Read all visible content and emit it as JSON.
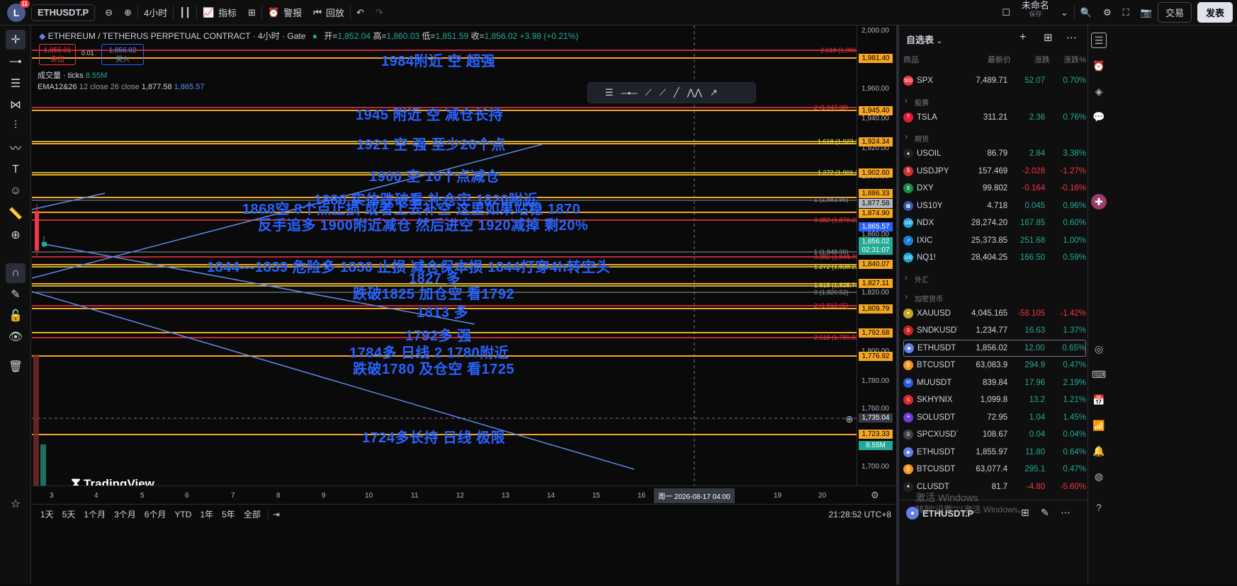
{
  "topbar": {
    "notif": "11",
    "avatar": "L",
    "symbol": "ETHUSDT.P",
    "interval": "4小时",
    "indicators": "指标",
    "alert": "警报",
    "replay": "回放",
    "layout_name": "未命名",
    "layout_sub": "保存",
    "trade": "交易",
    "publish": "发表"
  },
  "legend": {
    "title": "ETHEREUM / TETHERUS PERPETUAL CONTRACT · 4小时 · Gate",
    "o_label": "开=",
    "o": "1,852.04",
    "h_label": "高=",
    "h": "1,860.03",
    "l_label": "低=",
    "l": "1,851.59",
    "c_label": "收=",
    "c": "1,856.02",
    "chg": "+3.98 (+0.21%)",
    "sell_price": "1,856.01",
    "sell_label": "卖出",
    "spread": "0.01",
    "buy_price": "1,856.02",
    "buy_label": "买入",
    "vol_label": "成交量 · ticks",
    "vol_value": "8.55M",
    "ema_label": "EMA12&26",
    "ema_params": "12 close 26 close",
    "ema1": "1,877.58",
    "ema2": "1,865.57"
  },
  "annotations": [
    "1984附近 空 超强",
    "1945 附近 空    减仓长持",
    "1921 空  强 至少20个点",
    "1900 空  10个点减仓",
    "1880  实体跌破看 补仓空  1820附近",
    "1868空  8个点止损  或者上去补空  这里如果站稳 1870",
    "反手追多  1900附近减仓 然后进空 1920减掉 剩20%",
    "1844---1839  危险多 1830 止损  减仓保本损  1844打穿4h转空头",
    "1827 多",
    "跌破1825 加仓空 看1792",
    "1813 多",
    "1792多  强",
    "1784多 日线 2 1780附近",
    "跌破1780 及仓空 看1725",
    "1724多长持  日线 极限"
  ],
  "fib_labels": [
    "2.618 (1,986.58)",
    "2 (1,947.38)",
    "1.618 (1,923.15)",
    "1.272 (1,901.20)",
    "1 (1,883.95)",
    "0.382 (1,870.22)",
    "1 (1,848.00)",
    "0.382 (1,844.75)",
    "1.272 (1,838.22)",
    "1.618 (1,825.78)",
    "0 (1,820.52)",
    "2 (1,812.05)",
    "2.618 (1,789.83)"
  ],
  "price_ticks": [
    "2,000.00",
    "1,960.00",
    "1,940.00",
    "1,920.00",
    "1,900.00",
    "1,860.00",
    "1,820.00",
    "1,800.00",
    "1,780.00",
    "1,760.00",
    "1,740.00",
    "1,720.00",
    "1,700.00"
  ],
  "price_tags": [
    {
      "v": "1,981.40",
      "c": "#f5a623"
    },
    {
      "v": "1,945.40",
      "c": "#f5a623"
    },
    {
      "v": "1,924.34",
      "c": "#f5a623"
    },
    {
      "v": "1,902.60",
      "c": "#f5a623"
    },
    {
      "v": "1,886.33",
      "c": "#f5a623"
    },
    {
      "v": "1,877.58",
      "c": "#b2b5be"
    },
    {
      "v": "1,874.90",
      "c": "#f5a623"
    },
    {
      "v": "1,865.57",
      "c": "#2962ff"
    },
    {
      "v": "1,856.02",
      "c": "#22ab94"
    },
    {
      "v": "02:31:07",
      "c": "#22ab94"
    },
    {
      "v": "1,840.07",
      "c": "#f5a623"
    },
    {
      "v": "1,827.11",
      "c": "#f5a623"
    },
    {
      "v": "1,809.79",
      "c": "#f5a623"
    },
    {
      "v": "1,792.68",
      "c": "#f5a623"
    },
    {
      "v": "1,776.92",
      "c": "#f5a623"
    },
    {
      "v": "1,735.04",
      "c": "#363a45"
    },
    {
      "v": "1,723.33",
      "c": "#f5a623"
    },
    {
      "v": "8.55M",
      "c": "#22ab94"
    }
  ],
  "time_ticks": [
    "3",
    "4",
    "5",
    "6",
    "7",
    "8",
    "9",
    "10",
    "11",
    "12",
    "13",
    "14",
    "15",
    "16",
    "19",
    "20"
  ],
  "crosshair_time": "周一 2026-08-17   04:00",
  "bottom": {
    "ranges": [
      "1天",
      "5天",
      "1个月",
      "3个月",
      "6个月",
      "YTD",
      "1年",
      "5年",
      "全部"
    ],
    "clock": "21:28:52 UTC+8"
  },
  "tradingview": "TradingView",
  "watchlist": {
    "title": "自选表",
    "cols": [
      "商品",
      "最新价",
      "涨跌",
      "涨跌%"
    ],
    "rows": [
      {
        "t": "row",
        "sym": "SPX",
        "icon": "500",
        "ic": "#f23645",
        "last": "7,489.71",
        "chg": "52.07",
        "pct": "0.70%",
        "dir": "up"
      },
      {
        "t": "sec",
        "label": "股票"
      },
      {
        "t": "row",
        "sym": "TSLA",
        "icon": "T",
        "ic": "#e31937",
        "last": "311.21",
        "chg": "2.36",
        "pct": "0.76%",
        "dir": "up"
      },
      {
        "t": "sec",
        "label": "期货"
      },
      {
        "t": "row",
        "sym": "USOIL",
        "icon": "●",
        "ic": "#222",
        "last": "86.79",
        "chg": "2.84",
        "pct": "3.38%",
        "dir": "up"
      },
      {
        "t": "row",
        "sym": "USDJPY",
        "icon": "$",
        "ic": "#c33",
        "last": "157.469",
        "chg": "-2.028",
        "pct": "-1.27%",
        "dir": "dn"
      },
      {
        "t": "row",
        "sym": "DXY",
        "icon": "$",
        "ic": "#1b8a4c",
        "last": "99.802",
        "chg": "-0.164",
        "pct": "-0.16%",
        "dir": "dn"
      },
      {
        "t": "row",
        "sym": "US10Y",
        "icon": "▦",
        "ic": "#3355aa",
        "last": "4.718",
        "chg": "0.045",
        "pct": "0.96%",
        "dir": "up"
      },
      {
        "t": "row",
        "sym": "NDX",
        "icon": "100",
        "ic": "#1aa3d9",
        "last": "28,274.20",
        "chg": "167.85",
        "pct": "0.60%",
        "dir": "up"
      },
      {
        "t": "row",
        "sym": "IXIC",
        "icon": "↗",
        "ic": "#1a7fd9",
        "last": "25,373.85",
        "chg": "251.68",
        "pct": "1.00%",
        "dir": "up"
      },
      {
        "t": "row",
        "sym": "NQ1!",
        "icon": "100",
        "ic": "#1aa3d9",
        "last": "28,404.25",
        "chg": "166.50",
        "pct": "0.59%",
        "dir": "up"
      },
      {
        "t": "sec",
        "label": "外汇"
      },
      {
        "t": "sec",
        "label": "加密货币"
      },
      {
        "t": "row",
        "sym": "XAUUSD",
        "icon": "●",
        "ic": "#c9a227",
        "last": "4,045.165",
        "chg": "-58.105",
        "pct": "-1.42%",
        "dir": "dn"
      },
      {
        "t": "row",
        "sym": "SNDKUSDT",
        "icon": "S",
        "ic": "#cc2222",
        "last": "1,234.77",
        "chg": "16.63",
        "pct": "1.37%",
        "dir": "up"
      },
      {
        "t": "row",
        "sym": "ETHUSDT",
        "icon": "◆",
        "ic": "#627eea",
        "last": "1,856.02",
        "chg": "12.00",
        "pct": "0.65%",
        "dir": "up",
        "sel": true
      },
      {
        "t": "row",
        "sym": "BTCUSDT",
        "icon": "₿",
        "ic": "#f7931a",
        "last": "63,083.9",
        "chg": "294.9",
        "pct": "0.47%",
        "dir": "up"
      },
      {
        "t": "row",
        "sym": "MUUSDT",
        "icon": "M",
        "ic": "#2a5bd7",
        "last": "839.84",
        "chg": "17.96",
        "pct": "2.19%",
        "dir": "up"
      },
      {
        "t": "row",
        "sym": "SKHYNIX",
        "icon": "S",
        "ic": "#d9272e",
        "last": "1,099.8",
        "chg": "13.2",
        "pct": "1.21%",
        "dir": "up"
      },
      {
        "t": "row",
        "sym": "SOLUSDT",
        "icon": "≡",
        "ic": "#6a3fd9",
        "last": "72.95",
        "chg": "1.04",
        "pct": "1.45%",
        "dir": "up"
      },
      {
        "t": "row",
        "sym": "SPCXUSDT",
        "icon": "S",
        "ic": "#444",
        "last": "108.67",
        "chg": "0.04",
        "pct": "0.04%",
        "dir": "up"
      },
      {
        "t": "row",
        "sym": "ETHUSDT",
        "icon": "◆",
        "ic": "#627eea",
        "last": "1,855.97",
        "chg": "11.80",
        "pct": "0.64%",
        "dir": "up"
      },
      {
        "t": "row",
        "sym": "BTCUSDT",
        "icon": "₿",
        "ic": "#f7931a",
        "last": "63,077.4",
        "chg": "295.1",
        "pct": "0.47%",
        "dir": "up"
      },
      {
        "t": "row",
        "sym": "CLUSDT",
        "icon": "●",
        "ic": "#222",
        "last": "81.7",
        "chg": "-4.80",
        "pct": "-5.60%",
        "dir": "dn"
      }
    ],
    "footer": "ETHUSDT.P"
  },
  "windows_wm": {
    "line1": "激活 Windows",
    "line2": "转到\"设置\"以激活 Windows。"
  }
}
